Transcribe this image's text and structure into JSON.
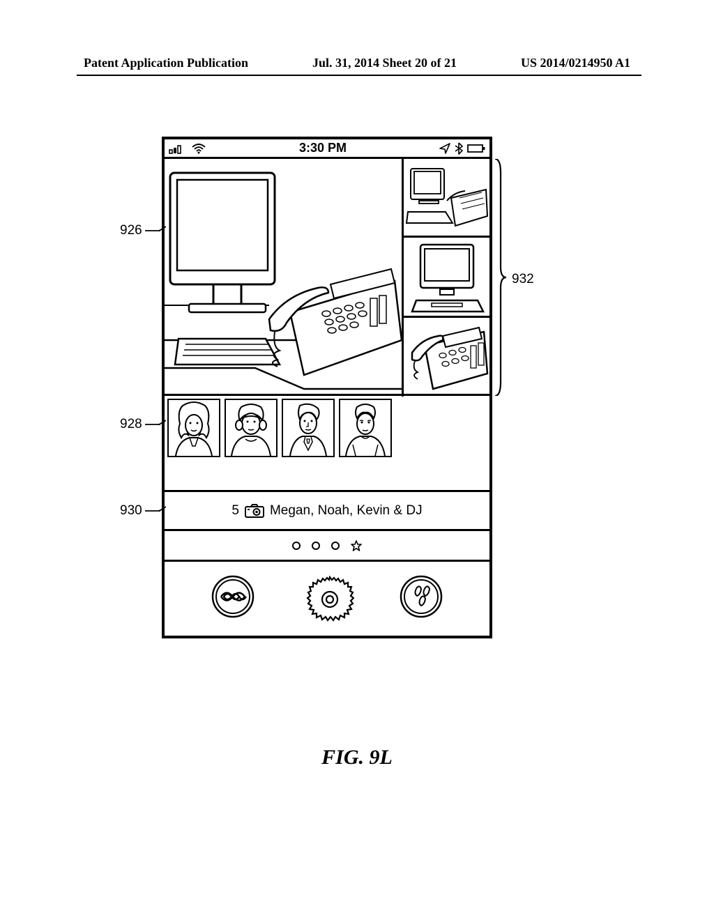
{
  "header": {
    "left": "Patent Application Publication",
    "center": "Jul. 31, 2014  Sheet 20 of 21",
    "right": "US 2014/0214950 A1"
  },
  "status_bar": {
    "time": "3:30 PM"
  },
  "caption": {
    "count": "5",
    "text": "Megan, Noah, Kevin & DJ"
  },
  "callouts": {
    "c926": "926",
    "c928": "928",
    "c930": "930",
    "c932": "932"
  },
  "figure_label": "FIG. 9L"
}
